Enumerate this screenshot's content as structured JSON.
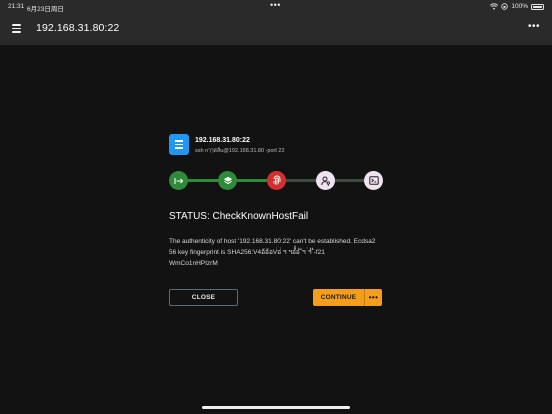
{
  "status_bar": {
    "time": "21:31",
    "date": "6月23日周日",
    "center_dots": "•••",
    "battery": "100%",
    "icons": [
      "wifi-icon",
      "screen-lock-icon",
      "battery-icon"
    ]
  },
  "app_bar": {
    "title": "192.168.31.80:22",
    "menu_icon": "hamburger-menu-icon",
    "more_icon": "more-options-icon",
    "more_glyph": "•••"
  },
  "host": {
    "name": "192.168.31.80:22",
    "command": "ssh nๅๅสส้u@192.168.31.80 -port 22",
    "icon": "server-list-icon",
    "icon_color": "#2196f3"
  },
  "progress": {
    "steps": [
      {
        "icon": "connect-arrow-icon",
        "glyph": "↦",
        "color": "#2e8b3a",
        "state": "done"
      },
      {
        "icon": "network-layers-icon",
        "glyph": "◆",
        "color": "#2e8b3a",
        "state": "done"
      },
      {
        "icon": "fingerprint-icon",
        "glyph": "◉",
        "color": "#d32f2f",
        "state": "failed"
      },
      {
        "icon": "user-key-icon",
        "glyph": "⚿",
        "color": "#efe3ef",
        "state": "pending"
      },
      {
        "icon": "terminal-icon",
        "glyph": "▣",
        "color": "#efe3ef",
        "state": "pending"
      }
    ],
    "done_color": "#2e8b3a",
    "pending_line_color": "#3d4a42"
  },
  "status": {
    "title": "STATUS: CheckKnownHostFail",
    "message_lines": [
      "The authenticity of host '192.168.31.80:22' can't be established. Ecdsa2",
      "56 key fingerprint is SHA256:V4อ้อ้อV่อ่่ ฯ ฯอํ็่อํ่ ํฯ ่ฯํ่ ํ่-f21",
      "WmCo1nHPIzrM"
    ]
  },
  "buttons": {
    "close": "CLOSE",
    "continue": "CONTINUE",
    "continue_more": "•••",
    "accent": "#f59e1b"
  }
}
